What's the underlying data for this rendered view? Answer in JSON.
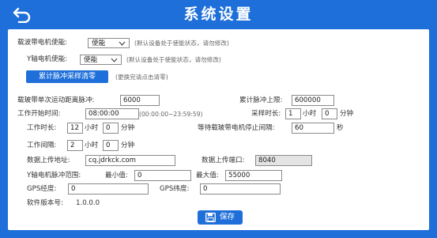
{
  "header": {
    "title": "系统设置",
    "back_icon": "back-arrow-icon"
  },
  "carrier_motor": {
    "label": "载波带电机使能:",
    "value": "使能",
    "hint": "(默认设备处于使能状态，请勿修改)"
  },
  "y_motor": {
    "label": "Y轴电机使能:",
    "value": "使能",
    "hint": "(默认设备处于使能状态，请勿修改)"
  },
  "clear_pulse": {
    "button": "累计脉冲采样清零",
    "hint": "(更换完请点击清零)"
  },
  "single_pulse": {
    "label": "载玻带单次运动距离脉冲:",
    "value": "6000"
  },
  "pulse_limit": {
    "label": "累计脉冲上限:",
    "value": "600000"
  },
  "start_time": {
    "label": "工作开始时间:",
    "value": "08:00:00",
    "hint": "(00:00:00~23:59:59)"
  },
  "sample_duration": {
    "label": "采样时长:",
    "hours": "1",
    "hour_unit": "小时",
    "minutes": "0",
    "minute_unit": "分钟"
  },
  "work_duration": {
    "label": "工作时长:",
    "hours": "12",
    "hour_unit": "小时",
    "minutes": "0",
    "minute_unit": "分钟"
  },
  "wait_interval": {
    "label": "等待载玻带电机停止间隔:",
    "value": "60",
    "unit": "秒"
  },
  "work_interval": {
    "label": "工作间隔:",
    "hours": "2",
    "hour_unit": "小时",
    "minutes": "0",
    "minute_unit": "分钟"
  },
  "upload_address": {
    "label": "数据上传地址:",
    "value": "cq.jdrkck.com"
  },
  "upload_port": {
    "label": "数据上传端口:",
    "value": "8040"
  },
  "y_pulse_range": {
    "label": "Y轴电机脉冲范围:",
    "min_label": "最小值:",
    "min": "0",
    "max_label": "最大值:",
    "max": "55000"
  },
  "gps": {
    "lon_label": "GPS经度:",
    "lon": "0",
    "lat_label": "GPS纬度:",
    "lat": "0"
  },
  "version": {
    "label": "软件版本号:",
    "value": "1.0.0.0"
  },
  "save": {
    "label": "保存",
    "icon": "save-icon"
  },
  "colors": {
    "primary": "#1e6fd9",
    "panel": "#ffffff",
    "disabled_input": "#e4e4e4"
  }
}
